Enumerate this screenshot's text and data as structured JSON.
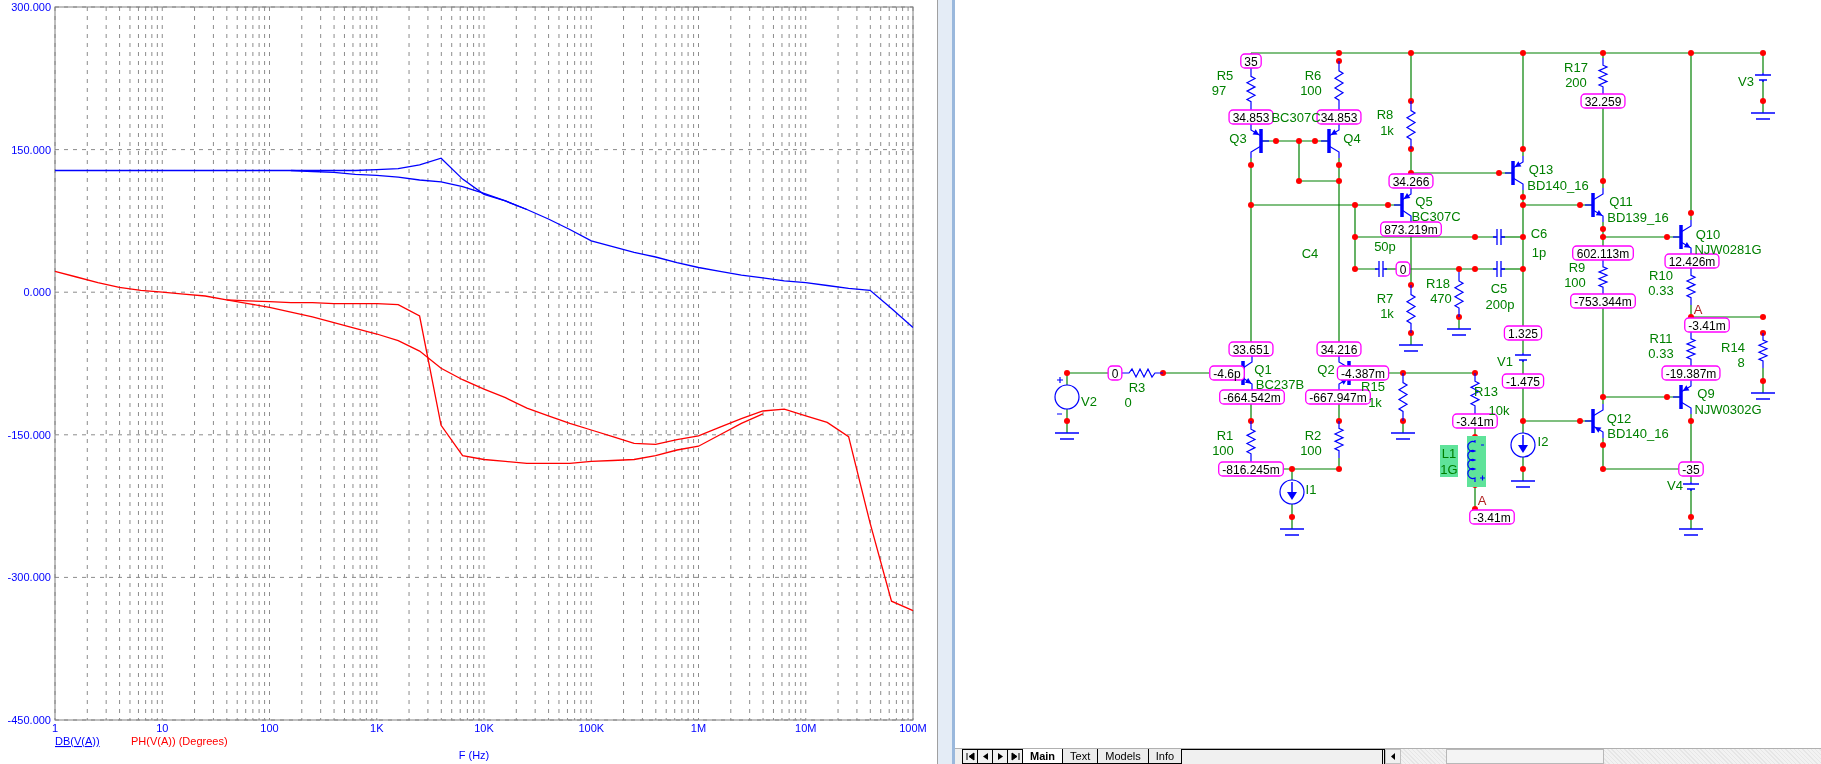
{
  "plot": {
    "chart_data": {
      "type": "line",
      "xlabel": "F (Hz)",
      "categories": [
        "1",
        null,
        null,
        null,
        null,
        "10",
        null,
        null,
        null,
        null,
        "100",
        null,
        null,
        null,
        null,
        "1K",
        null,
        null,
        null,
        null,
        "10K",
        null,
        null,
        null,
        null,
        "100K",
        null,
        null,
        null,
        null,
        "1M",
        null,
        null,
        null,
        null,
        "10M",
        null,
        null,
        null,
        null,
        "100M"
      ],
      "series": [
        {
          "color": "#0000ff",
          "values": [
            128,
            128,
            128,
            128,
            128,
            128,
            128,
            128,
            128,
            128,
            128,
            128,
            128,
            128,
            128,
            129,
            130,
            134,
            141,
            119,
            103,
            96,
            87,
            77,
            66,
            54,
            48,
            42,
            37,
            31,
            26,
            22,
            18,
            15,
            12,
            10,
            7,
            4,
            2,
            -17,
            -37
          ]
        },
        {
          "color": "#0000ff",
          "values": [
            null,
            null,
            null,
            null,
            null,
            null,
            null,
            null,
            null,
            null,
            null,
            128,
            127,
            126,
            124,
            123,
            121,
            118,
            116,
            111,
            104,
            96,
            87,
            null,
            null,
            null,
            null,
            null,
            null,
            null,
            null,
            null,
            null,
            null,
            null,
            null,
            null,
            null,
            null,
            null,
            null
          ]
        },
        {
          "color": "#ff0000",
          "values": [
            22,
            16,
            10,
            5,
            2,
            0,
            -2,
            -4,
            -8,
            -12,
            -16,
            -21,
            -26,
            -32,
            -38,
            -44,
            -51,
            -62,
            -80,
            -92,
            -102,
            -111,
            -122,
            -130,
            -138,
            -145,
            -152,
            -159,
            -160,
            -155,
            -151,
            -142,
            -133,
            -125,
            -123,
            -130,
            -137,
            -152,
            -243,
            -325,
            -335
          ]
        },
        {
          "color": "#ff0000",
          "values": [
            null,
            null,
            null,
            null,
            null,
            null,
            null,
            null,
            -8,
            -9,
            -10,
            -11,
            -11,
            -12,
            -12,
            -12,
            -13,
            -25,
            -140,
            -172,
            -176,
            -178,
            -180,
            -180,
            -180,
            -178,
            -177,
            -176,
            -172,
            -166,
            -162,
            -150,
            -138,
            -128,
            null,
            null,
            null,
            null,
            null,
            null,
            null
          ]
        }
      ],
      "ylim": [
        -450,
        300
      ],
      "grid": true,
      "yticks": [
        {
          "value": 300,
          "label": "300.000"
        },
        {
          "value": 150,
          "label": "150.000"
        },
        {
          "value": 0,
          "label": "0.000"
        },
        {
          "value": -150,
          "label": "-150.000"
        },
        {
          "value": -300,
          "label": "-300.000"
        },
        {
          "value": -450,
          "label": "-450.000"
        }
      ]
    },
    "legend": [
      {
        "label": "DB(V(A))",
        "color": "#0000ff",
        "selected": true
      },
      {
        "label": "PH(V(A)) (Degrees)",
        "color": "#ff0000",
        "selected": false
      }
    ]
  },
  "schematic": {
    "node_voltages": [
      "35",
      "34.853",
      "34.853",
      "34.266",
      "873.219m",
      "0",
      "32.259",
      "602.113m",
      "-753.344m",
      "12.426m",
      "-3.41m",
      "1.325",
      "33.651",
      "34.216",
      "0",
      "-4.6p",
      "-4.387m",
      "-664.542m",
      "-667.947m",
      "-19.387m",
      "-1.475",
      "-3.41m",
      "-816.245m",
      "-35",
      "-3.41m"
    ],
    "labels": [
      {
        "text": "R5",
        "kind": "part",
        "selected": false
      },
      {
        "text": "97",
        "kind": "part",
        "selected": false
      },
      {
        "text": "R6",
        "kind": "part",
        "selected": false
      },
      {
        "text": "100",
        "kind": "part",
        "selected": false
      },
      {
        "text": "BC307C",
        "kind": "part",
        "selected": false
      },
      {
        "text": "Q3",
        "kind": "part",
        "selected": false
      },
      {
        "text": "Q4",
        "kind": "part",
        "selected": false
      },
      {
        "text": "R8",
        "kind": "part",
        "selected": false
      },
      {
        "text": "1k",
        "kind": "part",
        "selected": false
      },
      {
        "text": "R17",
        "kind": "part",
        "selected": false
      },
      {
        "text": "200",
        "kind": "part",
        "selected": false
      },
      {
        "text": "V3",
        "kind": "part",
        "selected": false
      },
      {
        "text": "Q13",
        "kind": "part",
        "selected": false
      },
      {
        "text": "BD140_16",
        "kind": "part",
        "selected": false
      },
      {
        "text": "Q5",
        "kind": "part",
        "selected": false
      },
      {
        "text": "BC307C",
        "kind": "part",
        "selected": false
      },
      {
        "text": "Q11",
        "kind": "part",
        "selected": false
      },
      {
        "text": "BD139_16",
        "kind": "part",
        "selected": false
      },
      {
        "text": "C6",
        "kind": "part",
        "selected": false
      },
      {
        "text": "1p",
        "kind": "part",
        "selected": false
      },
      {
        "text": "Q10",
        "kind": "part",
        "selected": false
      },
      {
        "text": "NJW0281G",
        "kind": "part",
        "selected": false
      },
      {
        "text": "C4",
        "kind": "part",
        "selected": false
      },
      {
        "text": "50p",
        "kind": "part",
        "selected": false
      },
      {
        "text": "R9",
        "kind": "part",
        "selected": false
      },
      {
        "text": "100",
        "kind": "part",
        "selected": false
      },
      {
        "text": "R10",
        "kind": "part",
        "selected": false
      },
      {
        "text": "0.33",
        "kind": "part",
        "selected": false
      },
      {
        "text": "R18",
        "kind": "part",
        "selected": false
      },
      {
        "text": "470",
        "kind": "part",
        "selected": false
      },
      {
        "text": "C5",
        "kind": "part",
        "selected": false
      },
      {
        "text": "200p",
        "kind": "part",
        "selected": false
      },
      {
        "text": "R7",
        "kind": "part",
        "selected": false
      },
      {
        "text": "1k",
        "kind": "part",
        "selected": false
      },
      {
        "text": "A",
        "kind": "probe",
        "selected": false
      },
      {
        "text": "R11",
        "kind": "part",
        "selected": false
      },
      {
        "text": "0.33",
        "kind": "part",
        "selected": false
      },
      {
        "text": "R14",
        "kind": "part",
        "selected": false
      },
      {
        "text": "8",
        "kind": "part",
        "selected": false
      },
      {
        "text": "V1",
        "kind": "part",
        "selected": false
      },
      {
        "text": "Q1",
        "kind": "part",
        "selected": false
      },
      {
        "text": "BC237B",
        "kind": "part",
        "selected": false
      },
      {
        "text": "Q2",
        "kind": "part",
        "selected": false
      },
      {
        "text": "R15",
        "kind": "part",
        "selected": false
      },
      {
        "text": "1k",
        "kind": "part",
        "selected": false
      },
      {
        "text": "R3",
        "kind": "part",
        "selected": false
      },
      {
        "text": "V2",
        "kind": "part",
        "selected": false
      },
      {
        "text": "0",
        "kind": "part",
        "selected": false
      },
      {
        "text": "R13",
        "kind": "part",
        "selected": false
      },
      {
        "text": "10k",
        "kind": "part",
        "selected": false
      },
      {
        "text": "Q9",
        "kind": "part",
        "selected": false
      },
      {
        "text": "NJW0302G",
        "kind": "part",
        "selected": false
      },
      {
        "text": "Q12",
        "kind": "part",
        "selected": false
      },
      {
        "text": "R1",
        "kind": "part",
        "selected": false
      },
      {
        "text": "R2",
        "kind": "part",
        "selected": false
      },
      {
        "text": "BD140_16",
        "kind": "part",
        "selected": false
      },
      {
        "text": "100",
        "kind": "part",
        "selected": false
      },
      {
        "text": "100",
        "kind": "part",
        "selected": false
      },
      {
        "text": "L1",
        "kind": "part",
        "selected": true
      },
      {
        "text": "I2",
        "kind": "part",
        "selected": false
      },
      {
        "text": "1G",
        "kind": "part",
        "selected": true
      },
      {
        "text": "I1",
        "kind": "part",
        "selected": false
      },
      {
        "text": "V4",
        "kind": "part",
        "selected": false
      },
      {
        "text": "A",
        "kind": "probe",
        "selected": false
      }
    ],
    "inductor": {
      "selected": true
    }
  },
  "sheet_tabs": [
    {
      "label": "Main",
      "selected": true
    },
    {
      "label": "Text",
      "selected": false
    },
    {
      "label": "Models",
      "selected": false
    },
    {
      "label": "Info",
      "selected": false
    }
  ]
}
